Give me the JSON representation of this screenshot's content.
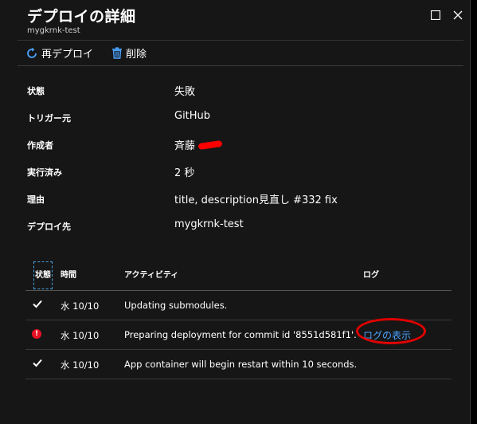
{
  "header": {
    "title": "デプロイの詳細",
    "subtitle": "mygkrnk-test"
  },
  "toolbar": {
    "redeploy_label": "再デプロイ",
    "delete_label": "削除"
  },
  "properties": [
    {
      "label": "状態",
      "value": "失敗"
    },
    {
      "label": "トリガー元",
      "value": "GitHub"
    },
    {
      "label": "作成者",
      "value": "斉藤"
    },
    {
      "label": "実行済み",
      "value": "2 秒"
    },
    {
      "label": "理由",
      "value": "title, description見直し #332 fix"
    },
    {
      "label": "デプロイ先",
      "value": "mygkrnk-test"
    }
  ],
  "table": {
    "headers": {
      "status": "状態",
      "time": "時間",
      "activity": "アクティビティ",
      "log": "ログ"
    },
    "rows": [
      {
        "status": "success",
        "time": "水 10/10",
        "activity": "Updating submodules.",
        "log": ""
      },
      {
        "status": "error",
        "time": "水 10/10",
        "activity": "Preparing deployment for commit id '8551d581f1'.",
        "log": "ログの表示"
      },
      {
        "status": "success",
        "time": "水 10/10",
        "activity": "App container will begin restart within 10 seconds.",
        "log": ""
      }
    ]
  },
  "colors": {
    "accent": "#4aa3ff",
    "error": "#e81123",
    "annotation": "#e00000"
  }
}
